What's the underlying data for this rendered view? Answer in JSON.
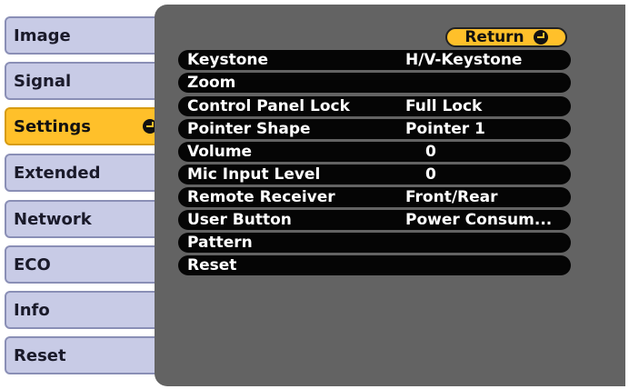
{
  "sidebar": {
    "items": [
      {
        "label": "Image"
      },
      {
        "label": "Signal"
      },
      {
        "label": "Settings"
      },
      {
        "label": "Extended"
      },
      {
        "label": "Network"
      },
      {
        "label": "ECO"
      },
      {
        "label": "Info"
      },
      {
        "label": "Reset"
      }
    ],
    "active_index": 2
  },
  "panel": {
    "return_label": "Return",
    "rows": [
      {
        "label": "Keystone",
        "value": "H/V-Keystone"
      },
      {
        "label": "Zoom",
        "value": ""
      },
      {
        "label": "Control Panel Lock",
        "value": "Full Lock"
      },
      {
        "label": "Pointer Shape",
        "value": "Pointer 1"
      },
      {
        "label": "Volume",
        "value": "0"
      },
      {
        "label": "Mic Input Level",
        "value": "0"
      },
      {
        "label": "Remote Receiver",
        "value": "Front/Rear"
      },
      {
        "label": "User Button",
        "value": "Power Consum..."
      },
      {
        "label": "Pattern",
        "value": ""
      },
      {
        "label": "Reset",
        "value": ""
      }
    ]
  },
  "colors": {
    "active_tab": "#ffc02a",
    "inactive_tab": "#c8cbe6",
    "panel_bg": "#636363",
    "row_bg": "#050505"
  },
  "icons": {
    "enter": "enter-icon"
  }
}
